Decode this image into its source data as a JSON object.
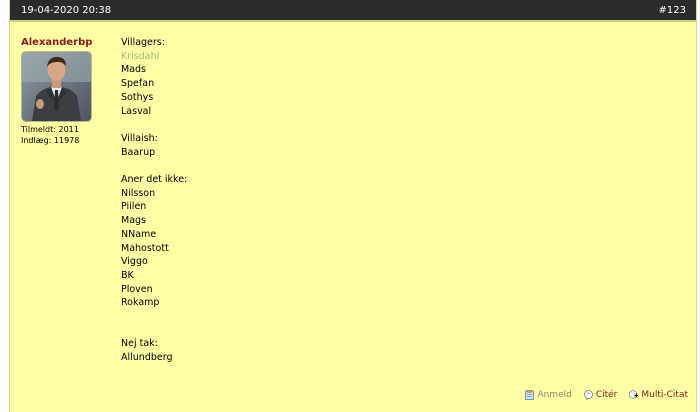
{
  "post": {
    "date": "19-04-2020 20:38",
    "number": "#123"
  },
  "user": {
    "name": "Alexanderbp",
    "joined": "Tilmeldt: 2011",
    "posts": "Indlæg: 11978"
  },
  "content": {
    "lines": [
      {
        "text": "Villagers:",
        "muted": false
      },
      {
        "text": "Krisdahl",
        "muted": true
      },
      {
        "text": "Mads",
        "muted": false
      },
      {
        "text": "Spefan",
        "muted": false
      },
      {
        "text": "Sothys",
        "muted": false
      },
      {
        "text": "Lasval",
        "muted": false
      },
      {
        "text": "",
        "muted": false
      },
      {
        "text": "Villaish:",
        "muted": false
      },
      {
        "text": "Baarup",
        "muted": false
      },
      {
        "text": "",
        "muted": false
      },
      {
        "text": "Aner det ikke:",
        "muted": false
      },
      {
        "text": "Nilsson",
        "muted": false
      },
      {
        "text": "Piilen",
        "muted": false
      },
      {
        "text": "Mags",
        "muted": false
      },
      {
        "text": "NName",
        "muted": false
      },
      {
        "text": "Mahostott",
        "muted": false
      },
      {
        "text": "Viggo",
        "muted": false
      },
      {
        "text": "BK",
        "muted": false
      },
      {
        "text": "Ploven",
        "muted": false
      },
      {
        "text": "Rokamp",
        "muted": false
      },
      {
        "text": "",
        "muted": false
      },
      {
        "text": "",
        "muted": false
      },
      {
        "text": "Nej tak:",
        "muted": false
      },
      {
        "text": "Allundberg",
        "muted": false
      }
    ]
  },
  "actions": {
    "report": "Anmeld",
    "quote": "Citér",
    "multiquote": "Multi-Citat"
  },
  "colors": {
    "header_bg": "#2b2b2b",
    "post_bg": "#ffffa6",
    "username": "#8b1a1a",
    "muted_name": "#96c57a"
  },
  "icons": {
    "report": "clipboard-icon",
    "quote": "quote-bubble-icon",
    "multiquote": "multi-quote-icon"
  }
}
